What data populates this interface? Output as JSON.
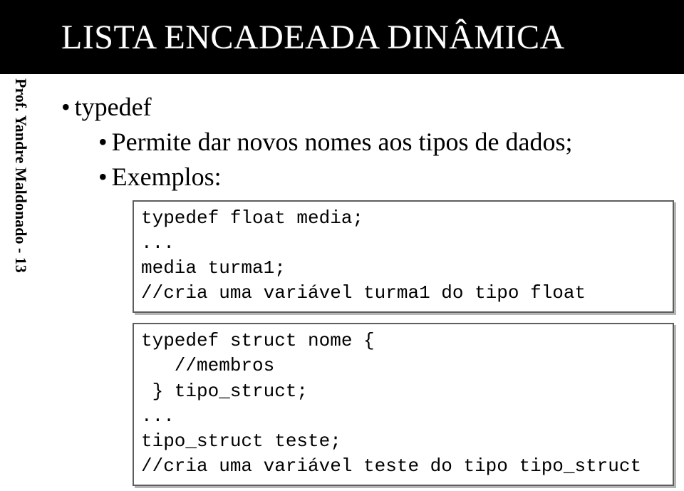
{
  "slide": {
    "title": "LISTA ENCADEADA DINÂMICA",
    "sidebar": "Prof. Yandre Maldonado - 13",
    "bullet1": "typedef",
    "bullet1a": "Permite dar novos nomes aos tipos de dados;",
    "bullet1b": "Exemplos:",
    "code1_l1": "typedef float media;",
    "code1_l2": "...",
    "code1_l3": "media turma1;",
    "code1_l4": "//cria uma variável turma1 do tipo float",
    "code2_l1": "typedef struct nome {",
    "code2_l2": "   //membros",
    "code2_l3": " } tipo_struct;",
    "code2_l4": "...",
    "code2_l5": "tipo_struct teste;",
    "code2_l6": "//cria uma variável teste do tipo tipo_struct"
  }
}
